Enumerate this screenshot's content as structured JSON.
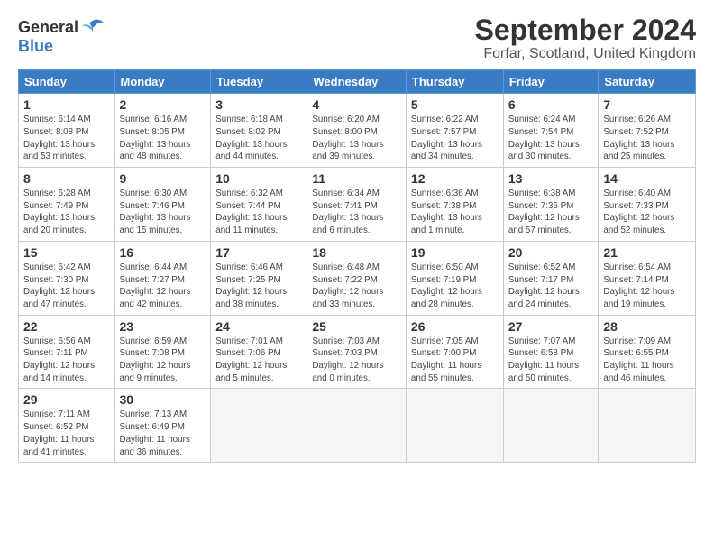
{
  "logo": {
    "general": "General",
    "blue": "Blue"
  },
  "title": "September 2024",
  "subtitle": "Forfar, Scotland, United Kingdom",
  "weekdays": [
    "Sunday",
    "Monday",
    "Tuesday",
    "Wednesday",
    "Thursday",
    "Friday",
    "Saturday"
  ],
  "weeks": [
    [
      {
        "day": "1",
        "info": "Sunrise: 6:14 AM\nSunset: 8:08 PM\nDaylight: 13 hours\nand 53 minutes."
      },
      {
        "day": "2",
        "info": "Sunrise: 6:16 AM\nSunset: 8:05 PM\nDaylight: 13 hours\nand 48 minutes."
      },
      {
        "day": "3",
        "info": "Sunrise: 6:18 AM\nSunset: 8:02 PM\nDaylight: 13 hours\nand 44 minutes."
      },
      {
        "day": "4",
        "info": "Sunrise: 6:20 AM\nSunset: 8:00 PM\nDaylight: 13 hours\nand 39 minutes."
      },
      {
        "day": "5",
        "info": "Sunrise: 6:22 AM\nSunset: 7:57 PM\nDaylight: 13 hours\nand 34 minutes."
      },
      {
        "day": "6",
        "info": "Sunrise: 6:24 AM\nSunset: 7:54 PM\nDaylight: 13 hours\nand 30 minutes."
      },
      {
        "day": "7",
        "info": "Sunrise: 6:26 AM\nSunset: 7:52 PM\nDaylight: 13 hours\nand 25 minutes."
      }
    ],
    [
      {
        "day": "8",
        "info": "Sunrise: 6:28 AM\nSunset: 7:49 PM\nDaylight: 13 hours\nand 20 minutes."
      },
      {
        "day": "9",
        "info": "Sunrise: 6:30 AM\nSunset: 7:46 PM\nDaylight: 13 hours\nand 15 minutes."
      },
      {
        "day": "10",
        "info": "Sunrise: 6:32 AM\nSunset: 7:44 PM\nDaylight: 13 hours\nand 11 minutes."
      },
      {
        "day": "11",
        "info": "Sunrise: 6:34 AM\nSunset: 7:41 PM\nDaylight: 13 hours\nand 6 minutes."
      },
      {
        "day": "12",
        "info": "Sunrise: 6:36 AM\nSunset: 7:38 PM\nDaylight: 13 hours\nand 1 minute."
      },
      {
        "day": "13",
        "info": "Sunrise: 6:38 AM\nSunset: 7:36 PM\nDaylight: 12 hours\nand 57 minutes."
      },
      {
        "day": "14",
        "info": "Sunrise: 6:40 AM\nSunset: 7:33 PM\nDaylight: 12 hours\nand 52 minutes."
      }
    ],
    [
      {
        "day": "15",
        "info": "Sunrise: 6:42 AM\nSunset: 7:30 PM\nDaylight: 12 hours\nand 47 minutes."
      },
      {
        "day": "16",
        "info": "Sunrise: 6:44 AM\nSunset: 7:27 PM\nDaylight: 12 hours\nand 42 minutes."
      },
      {
        "day": "17",
        "info": "Sunrise: 6:46 AM\nSunset: 7:25 PM\nDaylight: 12 hours\nand 38 minutes."
      },
      {
        "day": "18",
        "info": "Sunrise: 6:48 AM\nSunset: 7:22 PM\nDaylight: 12 hours\nand 33 minutes."
      },
      {
        "day": "19",
        "info": "Sunrise: 6:50 AM\nSunset: 7:19 PM\nDaylight: 12 hours\nand 28 minutes."
      },
      {
        "day": "20",
        "info": "Sunrise: 6:52 AM\nSunset: 7:17 PM\nDaylight: 12 hours\nand 24 minutes."
      },
      {
        "day": "21",
        "info": "Sunrise: 6:54 AM\nSunset: 7:14 PM\nDaylight: 12 hours\nand 19 minutes."
      }
    ],
    [
      {
        "day": "22",
        "info": "Sunrise: 6:56 AM\nSunset: 7:11 PM\nDaylight: 12 hours\nand 14 minutes."
      },
      {
        "day": "23",
        "info": "Sunrise: 6:59 AM\nSunset: 7:08 PM\nDaylight: 12 hours\nand 9 minutes."
      },
      {
        "day": "24",
        "info": "Sunrise: 7:01 AM\nSunset: 7:06 PM\nDaylight: 12 hours\nand 5 minutes."
      },
      {
        "day": "25",
        "info": "Sunrise: 7:03 AM\nSunset: 7:03 PM\nDaylight: 12 hours\nand 0 minutes."
      },
      {
        "day": "26",
        "info": "Sunrise: 7:05 AM\nSunset: 7:00 PM\nDaylight: 11 hours\nand 55 minutes."
      },
      {
        "day": "27",
        "info": "Sunrise: 7:07 AM\nSunset: 6:58 PM\nDaylight: 11 hours\nand 50 minutes."
      },
      {
        "day": "28",
        "info": "Sunrise: 7:09 AM\nSunset: 6:55 PM\nDaylight: 11 hours\nand 46 minutes."
      }
    ],
    [
      {
        "day": "29",
        "info": "Sunrise: 7:11 AM\nSunset: 6:52 PM\nDaylight: 11 hours\nand 41 minutes."
      },
      {
        "day": "30",
        "info": "Sunrise: 7:13 AM\nSunset: 6:49 PM\nDaylight: 11 hours\nand 36 minutes."
      },
      {
        "day": "",
        "info": ""
      },
      {
        "day": "",
        "info": ""
      },
      {
        "day": "",
        "info": ""
      },
      {
        "day": "",
        "info": ""
      },
      {
        "day": "",
        "info": ""
      }
    ]
  ]
}
